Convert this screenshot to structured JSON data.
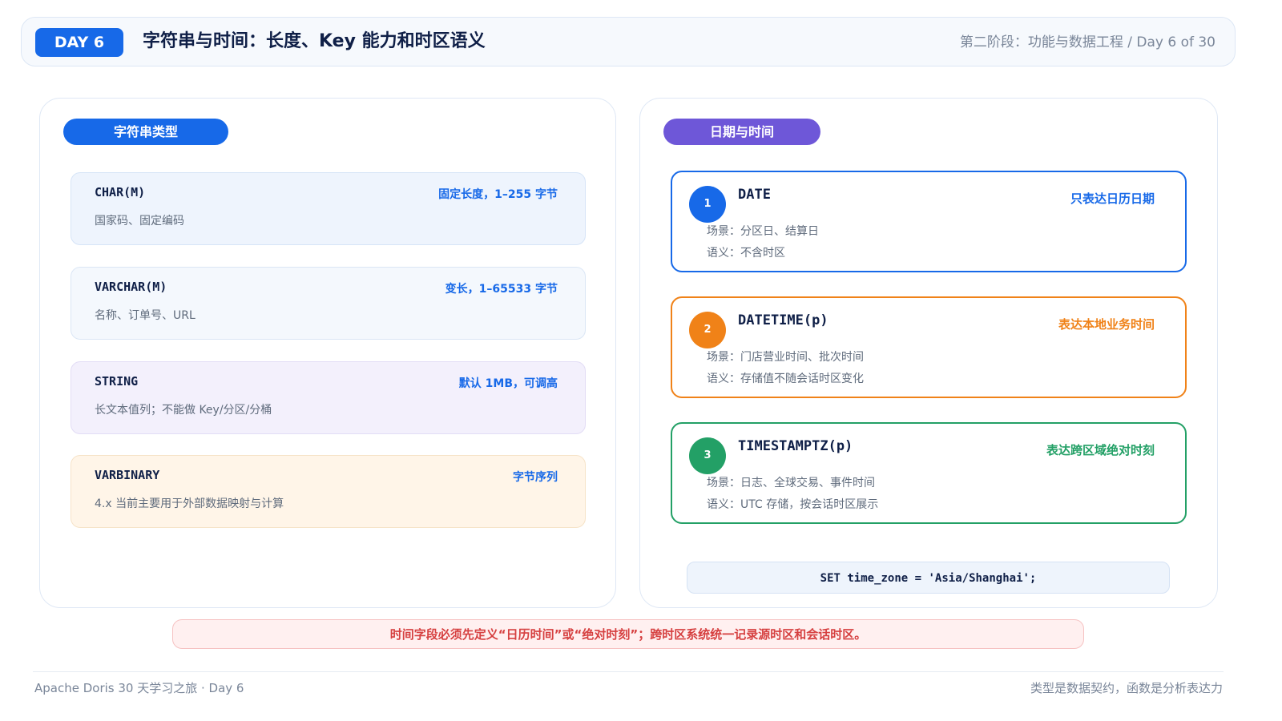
{
  "header": {
    "day_badge": "DAY 6",
    "title": "字符串与时间：长度、Key 能力和时区语义",
    "stage": "第二阶段：功能与数据工程 / Day 6 of 30"
  },
  "strings": {
    "section_label": "字符串类型",
    "items": [
      {
        "name": "CHAR(M)",
        "tag": "固定长度，1–255 字节",
        "desc": "国家码、固定编码",
        "bg": "#eef4fd",
        "border": "#d6e4f7"
      },
      {
        "name": "VARCHAR(M)",
        "tag": "变长，1–65533 字节",
        "desc": "名称、订单号、URL",
        "bg": "#f4f8fd",
        "border": "#dbe6f5"
      },
      {
        "name": "STRING",
        "tag": "默认 1MB，可调高",
        "desc": "长文本值列；不能做 Key/分区/分桶",
        "bg": "#f3f0fc",
        "border": "#e2dcf5"
      },
      {
        "name": "VARBINARY",
        "tag": "字节序列",
        "desc": "4.x 当前主要用于外部数据映射与计算",
        "bg": "#fff5e8",
        "border": "#f6e3c8"
      }
    ]
  },
  "times": {
    "section_label": "日期与时间",
    "items": [
      {
        "num": "1",
        "name": "DATE",
        "tag": "只表达日历日期",
        "scene": "场景：分区日、结算日",
        "semantics": "语义：不含时区",
        "color": "#1769e8"
      },
      {
        "num": "2",
        "name": "DATETIME(p)",
        "tag": "表达本地业务时间",
        "scene": "场景：门店营业时间、批次时间",
        "semantics": "语义：存储值不随会话时区变化",
        "color": "#f08218"
      },
      {
        "num": "3",
        "name": "TIMESTAMPTZ(p)",
        "tag": "表达跨区域绝对时刻",
        "scene": "场景：日志、全球交易、事件时间",
        "semantics": "语义：UTC 存储，按会话时区展示",
        "color": "#23a066"
      }
    ],
    "code": "SET time_zone = 'Asia/Shanghai';"
  },
  "warning": "时间字段必须先定义“日历时间”或“绝对时刻”；跨时区系统统一记录源时区和会话时区。",
  "footer": {
    "left": "Apache Doris 30 天学习之旅 · Day 6",
    "right": "类型是数据契约，函数是分析表达力"
  }
}
